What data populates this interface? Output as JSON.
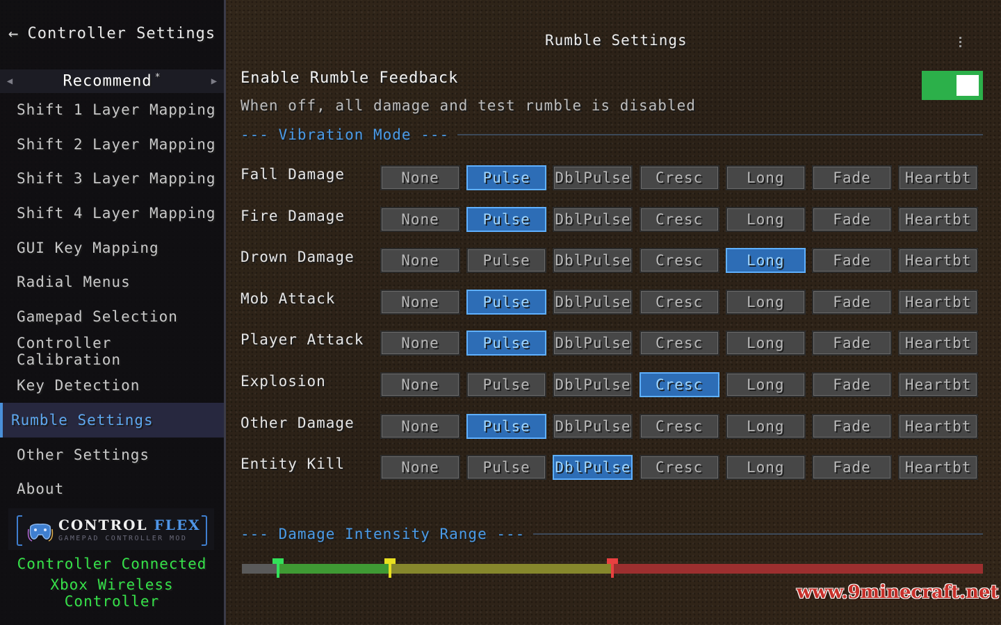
{
  "sidebar": {
    "back_label": "Controller Settings",
    "category": "Recommend",
    "category_marker": "*",
    "items": [
      {
        "label": "Shift 1 Layer Mapping"
      },
      {
        "label": "Shift 2 Layer Mapping"
      },
      {
        "label": "Shift 3 Layer Mapping"
      },
      {
        "label": "Shift 4 Layer Mapping"
      },
      {
        "label": "GUI Key Mapping"
      },
      {
        "label": "Radial Menus"
      },
      {
        "label": "Gamepad Selection"
      },
      {
        "label": "Controller Calibration"
      },
      {
        "label": "Key Detection"
      },
      {
        "label": "Rumble Settings",
        "active": true
      },
      {
        "label": "Other Settings"
      },
      {
        "label": "About"
      }
    ],
    "logo": {
      "title_a": "CONTROL",
      "title_b": "FLEX",
      "subtitle": "GAMEPAD CONTROLLER MOD"
    },
    "status_connected": "Controller Connected",
    "status_device": "Xbox Wireless Controller"
  },
  "main": {
    "title": "Rumble Settings",
    "enable": {
      "title": "Enable Rumble Feedback",
      "description": "When off, all damage and test rumble is disabled",
      "on": true
    },
    "vibration_section": "--- Vibration Mode ---",
    "modes": [
      "None",
      "Pulse",
      "DblPulse",
      "Cresc",
      "Long",
      "Fade",
      "Heartbt"
    ],
    "rows": [
      {
        "label": "Fall Damage",
        "selected": "Pulse"
      },
      {
        "label": "Fire Damage",
        "selected": "Pulse"
      },
      {
        "label": "Drown Damage",
        "selected": "Long"
      },
      {
        "label": "Mob Attack",
        "selected": "Pulse"
      },
      {
        "label": "Player Attack",
        "selected": "Pulse"
      },
      {
        "label": "Explosion",
        "selected": "Cresc"
      },
      {
        "label": "Other Damage",
        "selected": "Pulse"
      },
      {
        "label": "Entity Kill",
        "selected": "DblPulse"
      }
    ],
    "intensity_section": "--- Damage Intensity Range ---",
    "intensity": {
      "thresholds_fraction": [
        0.049,
        0.2,
        0.5
      ],
      "colors": [
        "#5a5a5a",
        "#3f9a34",
        "#86872c",
        "#9c2f2f"
      ],
      "handle_colors": [
        "#33e05a",
        "#e8e020",
        "#e84040"
      ]
    }
  },
  "colors": {
    "accent": "#4a90d9",
    "selected_button": "#2d6db6",
    "toggle_on": "#2cb04a",
    "status_green": "#36e24a"
  },
  "watermark": "www.9minecraft.net"
}
